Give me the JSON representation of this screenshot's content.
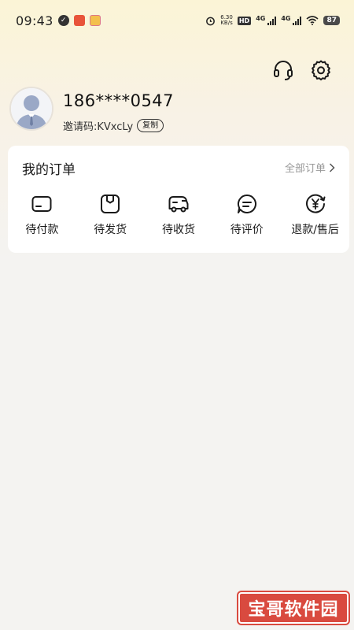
{
  "status_bar": {
    "time": "09:43",
    "net_speed_value": "6.30",
    "net_speed_unit": "KB/s",
    "hd_label": "HD",
    "network_1": "4G",
    "network_2": "4G",
    "battery": "87"
  },
  "header": {
    "support_icon": "headset-icon",
    "settings_icon": "gear-icon"
  },
  "profile": {
    "phone": "186****0547",
    "invite_code_label": "邀请码:KVxcLy",
    "copy_label": "复制"
  },
  "orders": {
    "title": "我的订单",
    "all_orders_label": "全部订单",
    "items": [
      {
        "label": "待付款",
        "icon": "card-icon"
      },
      {
        "label": "待发货",
        "icon": "box-icon"
      },
      {
        "label": "待收货",
        "icon": "truck-icon"
      },
      {
        "label": "待评价",
        "icon": "comment-icon"
      },
      {
        "label": "退款/售后",
        "icon": "yen-refund-icon"
      }
    ]
  },
  "watermark": {
    "text": "宝哥软件园"
  }
}
